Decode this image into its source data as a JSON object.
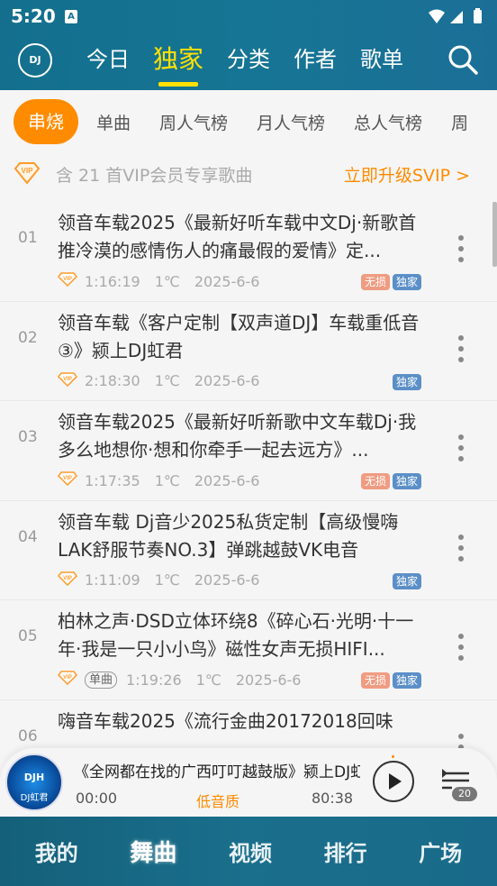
{
  "status": {
    "time": "5:20",
    "a_icon": "A"
  },
  "logo": {
    "text": "DJ"
  },
  "top_tabs": [
    "今日",
    "独家",
    "分类",
    "作者",
    "歌单"
  ],
  "top_active_index": 1,
  "chips": [
    "串烧",
    "单曲",
    "周人气榜",
    "月人气榜",
    "总人气榜",
    "周"
  ],
  "vip_bar": {
    "text": "含 21 首VIP会员专享歌曲",
    "upgrade": "立即升级SVIP >"
  },
  "songs": [
    {
      "num": "01",
      "title": "领音车载2025《最新好听车载中文Dj·新歌首推冷漠的感情伤人的痛最假的爱情》定...",
      "duration": "1:16:19",
      "temp": "1℃",
      "date": "2025-6-6",
      "lossless": true,
      "exclusive": true,
      "single": false
    },
    {
      "num": "02",
      "title": "领音车载《客户定制【双声道DJ】车载重低音③》颍上DJ虹君",
      "duration": "2:18:30",
      "temp": "1℃",
      "date": "2025-6-6",
      "lossless": false,
      "exclusive": true,
      "single": false
    },
    {
      "num": "03",
      "title": "领音车载2025《最新好听新歌中文车载Dj·我多么地想你·想和你牵手一起去远方》...",
      "duration": "1:17:35",
      "temp": "1℃",
      "date": "2025-6-6",
      "lossless": true,
      "exclusive": true,
      "single": false
    },
    {
      "num": "04",
      "title": "领音车载 Dj音少2025私货定制【高级慢嗨LAK舒服节奏NO.3】弹跳越鼓VK电音",
      "duration": "1:11:09",
      "temp": "1℃",
      "date": "2025-6-6",
      "lossless": false,
      "exclusive": true,
      "single": false
    },
    {
      "num": "05",
      "title": "柏林之声·DSD立体环绕8《碎心石·光明·十一年·我是一只小小鸟》磁性女声无损HIFI...",
      "duration": "1:19:26",
      "temp": "1℃",
      "date": "2025-6-6",
      "lossless": true,
      "exclusive": true,
      "single": true
    },
    {
      "num": "06",
      "title": "嗨音车载2025《流行金曲20172018回味",
      "duration": "",
      "temp": "",
      "date": "",
      "lossless": false,
      "exclusive": false,
      "single": false
    }
  ],
  "labels": {
    "lossless": "无损",
    "exclusive": "独家",
    "single": "单曲"
  },
  "player": {
    "title": "《全网都在找的广西叮叮越鼓版》颍上DJ虹君",
    "disc_text": "DJH",
    "disc_sub": "DJ虹君",
    "current": "00:00",
    "quality": "低音质",
    "total": "80:38",
    "queue_count": "20"
  },
  "bottom_nav": [
    "我的",
    "舞曲",
    "视频",
    "排行",
    "广场"
  ],
  "bottom_active_index": 1,
  "colors": {
    "accent": "#ff8c00",
    "header": "#167594",
    "tab_active": "#ffe100",
    "exclusive": "#5b8fc7",
    "lossless": "#ef9c82"
  }
}
